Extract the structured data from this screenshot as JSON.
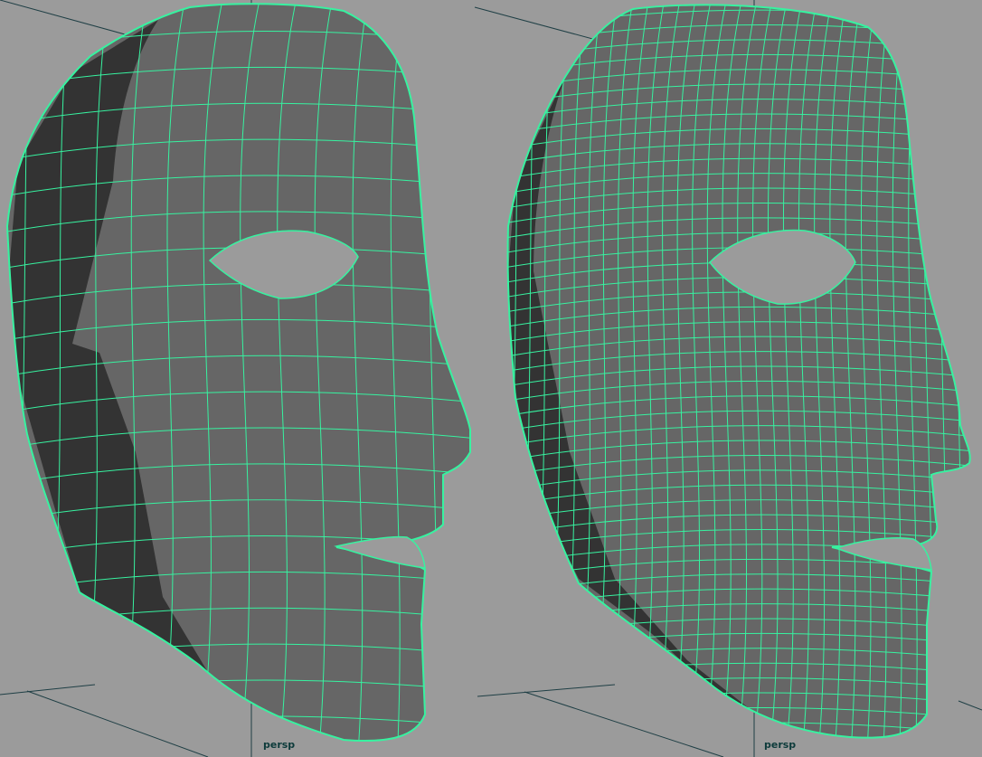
{
  "viewport": {
    "panels": [
      {
        "camera_label": "persp",
        "wire_density": 14
      },
      {
        "camera_label": "persp",
        "wire_density": 34
      }
    ],
    "colors": {
      "background": "#9b9b9b",
      "grid": "#1f3f45",
      "mesh_face": "#666666",
      "mesh_shadow": "#333333",
      "wireframe": "#37f2a0",
      "label": "#0d3b3b"
    }
  }
}
